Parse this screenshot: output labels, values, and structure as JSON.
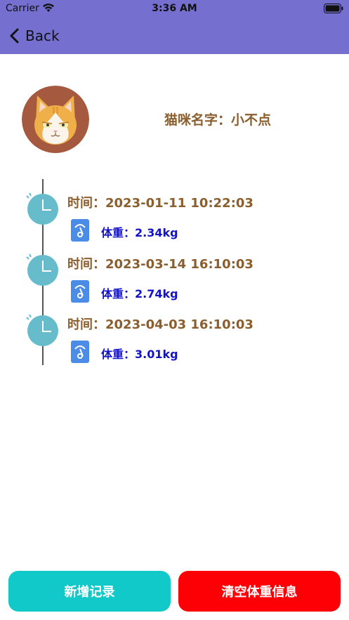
{
  "status_bar": {
    "carrier": "Carrier",
    "time": "3:36 AM"
  },
  "nav": {
    "back_label": "Back"
  },
  "profile": {
    "name_line": "猫咪名字：小不点"
  },
  "records": [
    {
      "time": "时间：2023-01-11 10:22:03",
      "weight": "体重：2.34kg"
    },
    {
      "time": "时间：2023-03-14 16:10:03",
      "weight": "体重：2.74kg"
    },
    {
      "time": "时间：2023-04-03 16:10:03",
      "weight": "体重：3.01kg"
    }
  ],
  "buttons": {
    "add_label": "新增记录",
    "clear_label": "清空体重信息"
  },
  "colors": {
    "nav_bg": "#7570cf",
    "name_text": "#8b5e2e",
    "weight_text": "#1212c8",
    "add_button": "#12c9c9",
    "clear_button": "#fc0006",
    "clock": "#67bccb",
    "scale": "#4a8ce6"
  },
  "icons": {
    "wifi": "wifi-icon",
    "battery": "battery-icon",
    "back": "chevron-left-icon",
    "avatar": "cat-avatar",
    "clock": "clock-icon",
    "scale": "scale-icon"
  }
}
